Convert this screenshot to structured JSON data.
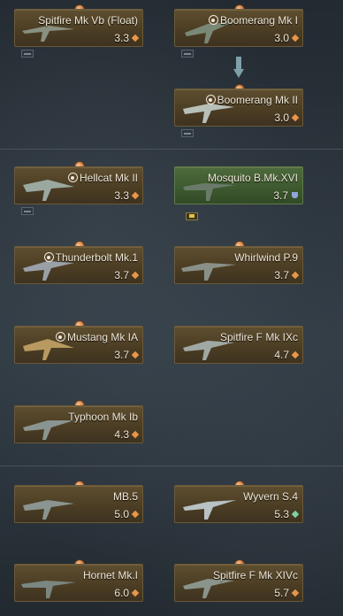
{
  "cards": [
    {
      "id": "spitfire-vb-float",
      "name": "Spitfire Mk Vb (Float)",
      "br": "3.3",
      "target": false,
      "rank": "diamond",
      "premium": false
    },
    {
      "id": "boomerang-i",
      "name": "Boomerang Mk I",
      "br": "3.0",
      "target": true,
      "rank": "diamond",
      "premium": false
    },
    {
      "id": "boomerang-ii",
      "name": "Boomerang Mk II",
      "br": "3.0",
      "target": true,
      "rank": "diamond",
      "premium": false
    },
    {
      "id": "hellcat-ii",
      "name": "Hellcat Mk II",
      "br": "3.3",
      "target": true,
      "rank": "diamond",
      "premium": false
    },
    {
      "id": "mosquito-b16",
      "name": "Mosquito B.Mk.XVI",
      "br": "3.7",
      "target": false,
      "rank": "shield",
      "premium": true
    },
    {
      "id": "thunderbolt-1",
      "name": "Thunderbolt Mk.1",
      "br": "3.7",
      "target": true,
      "rank": "diamond",
      "premium": false
    },
    {
      "id": "whirlwind-p9",
      "name": "Whirlwind P.9",
      "br": "3.7",
      "target": false,
      "rank": "diamond",
      "premium": false
    },
    {
      "id": "mustang-ia",
      "name": "Mustang Mk IA",
      "br": "3.7",
      "target": true,
      "rank": "diamond",
      "premium": false
    },
    {
      "id": "spitfire-f-ixc",
      "name": "Spitfire F Mk IXc",
      "br": "4.7",
      "target": false,
      "rank": "diamond",
      "premium": false
    },
    {
      "id": "typhoon-ib",
      "name": "Typhoon Mk Ib",
      "br": "4.3",
      "target": false,
      "rank": "diamond",
      "premium": false
    },
    {
      "id": "mb5",
      "name": "MB.5",
      "br": "5.0",
      "target": false,
      "rank": "diamond",
      "premium": false
    },
    {
      "id": "wyvern-s4",
      "name": "Wyvern S.4",
      "br": "5.3",
      "target": false,
      "rank": "gem",
      "premium": false
    },
    {
      "id": "hornet-i",
      "name": "Hornet Mk.I",
      "br": "6.0",
      "target": false,
      "rank": "diamond",
      "premium": false
    },
    {
      "id": "spitfire-f-xivc",
      "name": "Spitfire F Mk XIVc",
      "br": "5.7",
      "target": false,
      "rank": "diamond",
      "premium": false
    }
  ],
  "icons": {
    "target": "crosshair-icon",
    "rank": "rank-diamond-icon",
    "shield": "shield-icon",
    "gem": "gem-icon",
    "arrow": "down-arrow-icon"
  },
  "colors": {
    "card_bg": "#4c3e24",
    "premium_bg": "#3e5a30",
    "text": "#f0e8d8",
    "rank_orange": "#e8964a"
  }
}
